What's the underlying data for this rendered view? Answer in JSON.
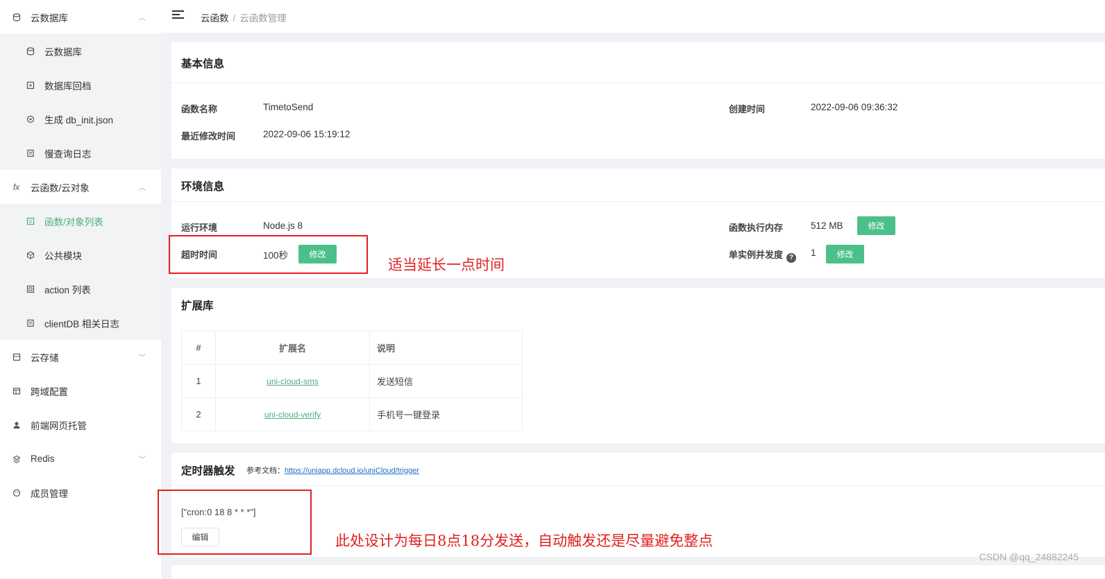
{
  "sidebar": {
    "items": [
      {
        "label": "云数据库",
        "icon": "database-icon",
        "arrow": "up"
      },
      {
        "label": "云数据库",
        "icon": "database-icon"
      },
      {
        "label": "数据库回档",
        "icon": "restore-icon"
      },
      {
        "label": "生成 db_init.json",
        "icon": "generate-icon"
      },
      {
        "label": "慢查询日志",
        "icon": "log-icon"
      },
      {
        "label": "云函数/云对象",
        "icon": "fx-icon",
        "arrow": "up"
      },
      {
        "label": "函数/对象列表",
        "icon": "list-icon",
        "active": true
      },
      {
        "label": "公共模块",
        "icon": "module-icon"
      },
      {
        "label": "action 列表",
        "icon": "action-icon"
      },
      {
        "label": "clientDB 相关日志",
        "icon": "log-icon"
      },
      {
        "label": "云存储",
        "icon": "storage-icon",
        "arrow": "down"
      },
      {
        "label": "跨域配置",
        "icon": "cors-icon"
      },
      {
        "label": "前端网页托管",
        "icon": "hosting-icon"
      },
      {
        "label": "Redis",
        "icon": "redis-icon",
        "arrow": "down"
      },
      {
        "label": "成员管理",
        "icon": "member-icon"
      }
    ]
  },
  "breadcrumb": {
    "root": "云函数",
    "sep": "/",
    "current": "云函数管理"
  },
  "basic": {
    "title": "基本信息",
    "name_label": "函数名称",
    "name_value": "TimetoSend",
    "created_label": "创建时间",
    "created_value": "2022-09-06 09:36:32",
    "modified_label": "最近修改时间",
    "modified_value": "2022-09-06 15:19:12"
  },
  "env": {
    "title": "环境信息",
    "runtime_label": "运行环境",
    "runtime_value": "Node.js 8",
    "memory_label": "函数执行内存",
    "memory_value": "512 MB",
    "timeout_label": "超时时间",
    "timeout_value": "100秒",
    "concurrency_label": "单实例并发度",
    "concurrency_value": "1",
    "edit_label": "修改"
  },
  "extensions": {
    "title": "扩展库",
    "headers": [
      "#",
      "扩展名",
      "说明"
    ],
    "rows": [
      {
        "num": "1",
        "name": "uni-cloud-sms",
        "desc": "发送短信"
      },
      {
        "num": "2",
        "name": "uni-cloud-verify",
        "desc": "手机号一键登录"
      }
    ]
  },
  "trigger": {
    "title": "定时器触发",
    "ref_label": "参考文档：",
    "ref_url": "https://uniapp.dcloud.io/uniCloud/trigger",
    "cron": "[\"cron:0 18 8 * * *\"]",
    "edit_label": "编辑"
  },
  "annotations": {
    "timeout_note": "适当延长一点时间",
    "cron_note": "此处设计为每日8点18分发送，自动触发还是尽量避免整点",
    "color": "#e02020"
  },
  "watermark": "CSDN @qq_24882245",
  "colors": {
    "accent": "#4caf7d",
    "button": "#4cc08a",
    "link": "#1a6ec7"
  }
}
